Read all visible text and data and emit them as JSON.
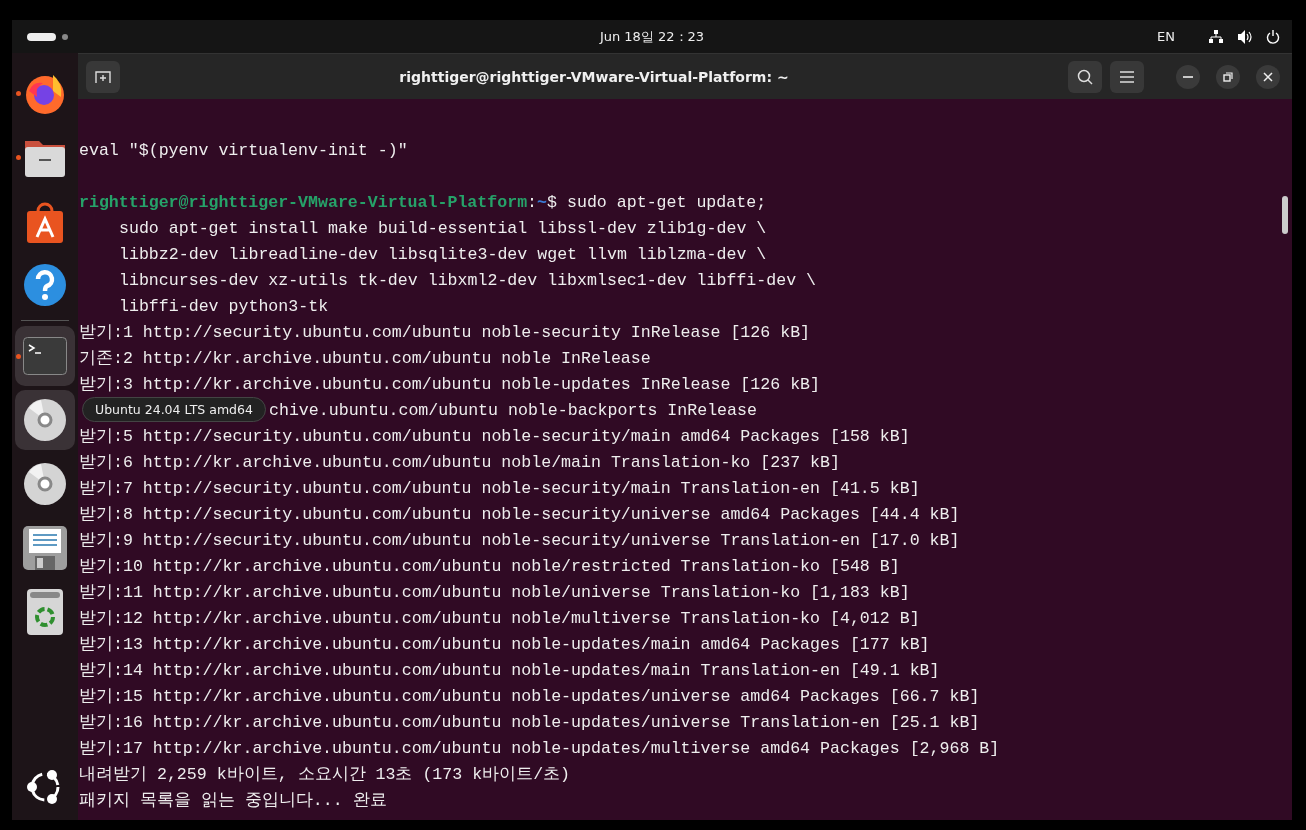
{
  "top_bar": {
    "clock": "Jun 18일 22：23",
    "language": "EN"
  },
  "dock": {
    "items": [
      {
        "kind": "firefox",
        "running": true,
        "highlighted": false
      },
      {
        "kind": "files",
        "running": true,
        "highlighted": false
      },
      {
        "kind": "app-center",
        "running": false,
        "highlighted": false
      },
      {
        "kind": "help",
        "running": false,
        "highlighted": false
      },
      {
        "kind": "separator"
      },
      {
        "kind": "terminal",
        "running": true,
        "highlighted": true
      },
      {
        "kind": "disc",
        "running": false,
        "highlighted": true
      },
      {
        "kind": "disc",
        "running": false,
        "highlighted": false
      },
      {
        "kind": "editor",
        "running": false,
        "highlighted": false
      },
      {
        "kind": "trash",
        "running": false,
        "highlighted": false
      }
    ],
    "tooltip": "Ubuntu 24.04 LTS amd64"
  },
  "window": {
    "title": "righttiger@righttiger-VMware-Virtual-Platform: ~"
  },
  "terminal": {
    "blocks": [
      {
        "lines": [
          {
            "kind": "output",
            "text": "eval \"$(pyenv virtualenv-init -)\""
          }
        ]
      },
      {
        "prompt": {
          "user_host": "righttiger@righttiger-VMware-Virtual-Platform",
          "separator": ":",
          "path": "~",
          "command": "$ sudo apt-get update;"
        },
        "lines": [
          {
            "kind": "continuation",
            "text": "sudo apt-get install make build-essential libssl-dev zlib1g-dev \\"
          },
          {
            "kind": "continuation",
            "text": "libbz2-dev libreadline-dev libsqlite3-dev wget llvm liblzma-dev \\"
          },
          {
            "kind": "continuation",
            "text": "libncurses-dev xz-utils tk-dev libxml2-dev libxmlsec1-dev libffi-dev \\"
          },
          {
            "kind": "continuation",
            "text": "libffi-dev python3-tk"
          },
          {
            "kind": "output",
            "text": "받기:1 http://security.ubuntu.com/ubuntu noble-security InRelease [126 kB]"
          },
          {
            "kind": "output",
            "text": "기존:2 http://kr.archive.ubuntu.com/ubuntu noble InRelease"
          },
          {
            "kind": "output",
            "text": "받기:3 http://kr.archive.ubuntu.com/ubuntu noble-updates InRelease [126 kB]"
          },
          {
            "kind": "covered",
            "text": "chive.ubuntu.com/ubuntu noble-backports InRelease"
          },
          {
            "kind": "output",
            "text": "받기:5 http://security.ubuntu.com/ubuntu noble-security/main amd64 Packages [158 kB]"
          },
          {
            "kind": "output",
            "text": "받기:6 http://kr.archive.ubuntu.com/ubuntu noble/main Translation-ko [237 kB]"
          },
          {
            "kind": "output",
            "text": "받기:7 http://security.ubuntu.com/ubuntu noble-security/main Translation-en [41.5 kB]"
          },
          {
            "kind": "output",
            "text": "받기:8 http://security.ubuntu.com/ubuntu noble-security/universe amd64 Packages [44.4 kB]"
          },
          {
            "kind": "output",
            "text": "받기:9 http://security.ubuntu.com/ubuntu noble-security/universe Translation-en [17.0 kB]"
          },
          {
            "kind": "output",
            "text": "받기:10 http://kr.archive.ubuntu.com/ubuntu noble/restricted Translation-ko [548 B]"
          },
          {
            "kind": "output",
            "text": "받기:11 http://kr.archive.ubuntu.com/ubuntu noble/universe Translation-ko [1,183 kB]"
          },
          {
            "kind": "output",
            "text": "받기:12 http://kr.archive.ubuntu.com/ubuntu noble/multiverse Translation-ko [4,012 B]"
          },
          {
            "kind": "output",
            "text": "받기:13 http://kr.archive.ubuntu.com/ubuntu noble-updates/main amd64 Packages [177 kB]"
          },
          {
            "kind": "output",
            "text": "받기:14 http://kr.archive.ubuntu.com/ubuntu noble-updates/main Translation-en [49.1 kB]"
          },
          {
            "kind": "output",
            "text": "받기:15 http://kr.archive.ubuntu.com/ubuntu noble-updates/universe amd64 Packages [66.7 kB]"
          },
          {
            "kind": "output",
            "text": "받기:16 http://kr.archive.ubuntu.com/ubuntu noble-updates/universe Translation-en [25.1 kB]"
          },
          {
            "kind": "output",
            "text": "받기:17 http://kr.archive.ubuntu.com/ubuntu noble-updates/multiverse amd64 Packages [2,968 B]"
          },
          {
            "kind": "output",
            "text": "내려받기 2,259 k바이트, 소요시간 13초 (173 k바이트/초)"
          },
          {
            "kind": "output",
            "text": "패키지 목록을 읽는 중입니다... 완료"
          }
        ]
      }
    ]
  }
}
